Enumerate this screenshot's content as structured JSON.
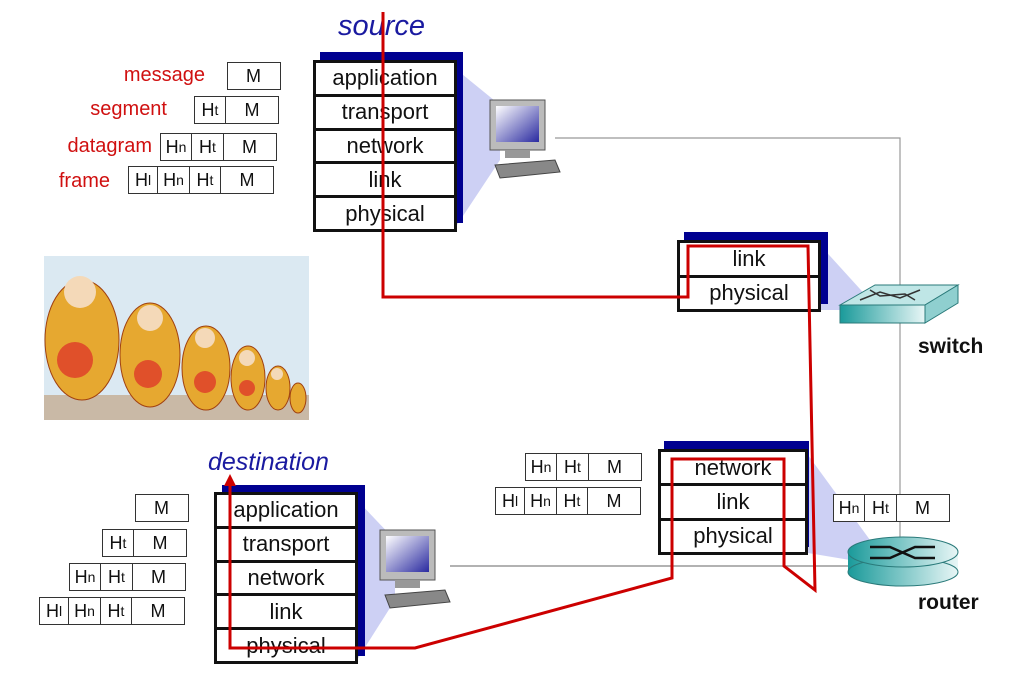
{
  "source": {
    "title": "source",
    "layers": [
      "application",
      "transport",
      "network",
      "link",
      "physical"
    ]
  },
  "destination": {
    "title": "destination",
    "layers": [
      "application",
      "transport",
      "network",
      "link",
      "physical"
    ]
  },
  "switch": {
    "label": "switch",
    "layers": [
      "link",
      "physical"
    ]
  },
  "router": {
    "label": "router",
    "layers": [
      "network",
      "link",
      "physical"
    ]
  },
  "encapsulation_labels": [
    "message",
    "segment",
    "datagram",
    "frame"
  ],
  "packets": {
    "source": [
      [
        {
          "b": "M",
          "s": ""
        }
      ],
      [
        {
          "b": "H",
          "s": "t"
        },
        {
          "b": "M",
          "s": ""
        }
      ],
      [
        {
          "b": "H",
          "s": "n"
        },
        {
          "b": "H",
          "s": "t"
        },
        {
          "b": "M",
          "s": ""
        }
      ],
      [
        {
          "b": "H",
          "s": "l"
        },
        {
          "b": "H",
          "s": "n"
        },
        {
          "b": "H",
          "s": "t"
        },
        {
          "b": "M",
          "s": ""
        }
      ]
    ],
    "destination": [
      [
        {
          "b": "M",
          "s": ""
        }
      ],
      [
        {
          "b": "H",
          "s": "t"
        },
        {
          "b": "M",
          "s": ""
        }
      ],
      [
        {
          "b": "H",
          "s": "n"
        },
        {
          "b": "H",
          "s": "t"
        },
        {
          "b": "M",
          "s": ""
        }
      ],
      [
        {
          "b": "H",
          "s": "l"
        },
        {
          "b": "H",
          "s": "n"
        },
        {
          "b": "H",
          "s": "t"
        },
        {
          "b": "M",
          "s": ""
        }
      ]
    ],
    "router_in": [
      [
        {
          "b": "H",
          "s": "n"
        },
        {
          "b": "H",
          "s": "t"
        },
        {
          "b": "M",
          "s": ""
        }
      ],
      [
        {
          "b": "H",
          "s": "l"
        },
        {
          "b": "H",
          "s": "n"
        },
        {
          "b": "H",
          "s": "t"
        },
        {
          "b": "M",
          "s": ""
        }
      ]
    ],
    "router_out": [
      [
        {
          "b": "H",
          "s": "n"
        },
        {
          "b": "H",
          "s": "t"
        },
        {
          "b": "M",
          "s": ""
        }
      ]
    ]
  },
  "colors": {
    "path": "#cc0000",
    "label": "#d01010",
    "title": "#1a1aa0",
    "shadow": "#000090"
  }
}
